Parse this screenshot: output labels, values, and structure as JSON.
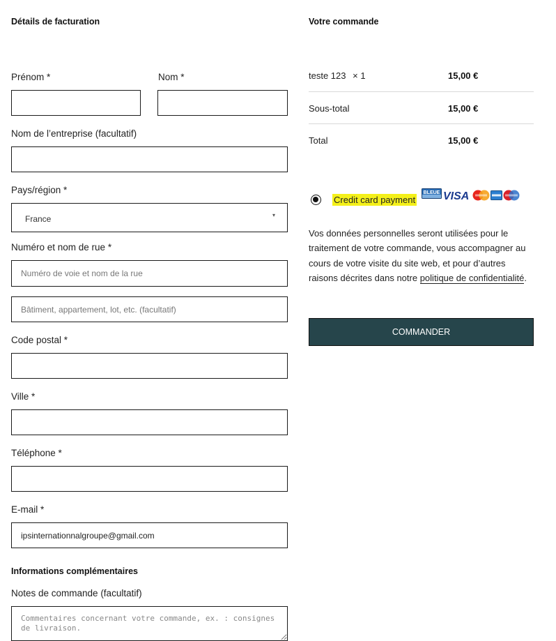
{
  "billing": {
    "title": "Détails de facturation",
    "first_name_label": "Prénom *",
    "last_name_label": "Nom *",
    "company_label": "Nom de l’entreprise (facultatif)",
    "country_label": "Pays/région *",
    "country_value": "France",
    "street_label": "Numéro et nom de rue *",
    "street_placeholder": "Numéro de voie et nom de la rue",
    "street2_placeholder": "Bâtiment, appartement, lot, etc. (facultatif)",
    "postcode_label": "Code postal *",
    "city_label": "Ville *",
    "phone_label": "Téléphone *",
    "email_label": "E-mail *",
    "email_value": "ipsinternationnalgroupe@gmail.com"
  },
  "additional": {
    "title": "Informations complémentaires",
    "notes_label": "Notes de commande (facultatif)",
    "notes_placeholder": "Commentaires concernant votre commande, ex. : consignes de livraison."
  },
  "order": {
    "title": "Votre commande",
    "item_name": "teste 123",
    "item_qty": "× 1",
    "item_total": "15,00 €",
    "subtotal_label": "Sous-total",
    "subtotal_value": "15,00 €",
    "total_label": "Total",
    "total_value": "15,00 €"
  },
  "payment": {
    "method_label": "Credit card payment",
    "selected": true,
    "card_logos": [
      "cb-bleue-logo",
      "visa-logo",
      "mastercard-logo",
      "amex-logo",
      "maestro-logo"
    ],
    "cb_text": "BLEUE",
    "visa_text": "VISA"
  },
  "privacy": {
    "text_before": "Vos données personnelles seront utilisées pour le traitement de votre commande, vous accompagner au cours de votre visite du site web, et pour d’autres raisons décrites dans notre ",
    "link_text": "politique de confidentialité",
    "text_after": "."
  },
  "submit": {
    "label": "COMMANDER"
  },
  "colors": {
    "button_bg": "#26454b",
    "highlight": "#f4f01a",
    "border": "#1a1a1a"
  }
}
